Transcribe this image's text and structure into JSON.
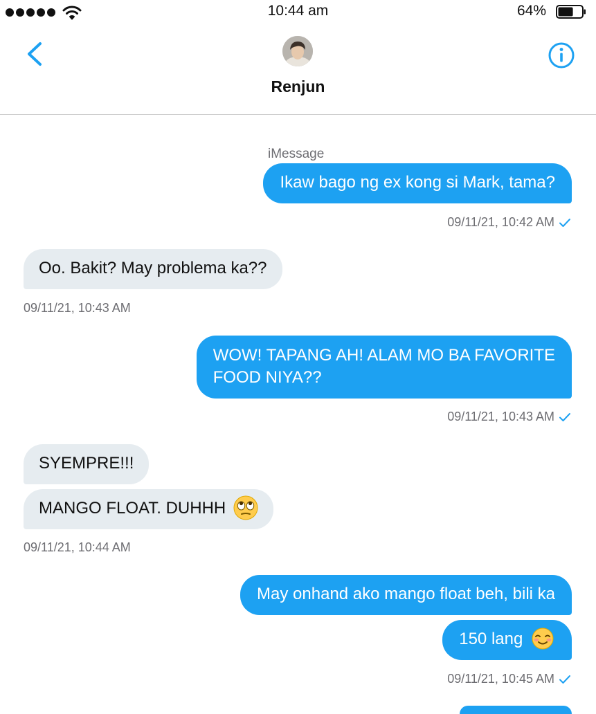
{
  "status_bar": {
    "time": "10:44 am",
    "battery_percent": "64%",
    "battery_level": 0.64,
    "icons": [
      "signal-dots-icon",
      "wifi-icon",
      "battery-icon"
    ]
  },
  "header": {
    "contact_name": "Renjun",
    "icons": [
      "back-chevron-icon",
      "info-icon"
    ],
    "accent_color": "#1da1f2"
  },
  "conversation": {
    "service_label": "iMessage",
    "messages": [
      {
        "direction": "out",
        "text": "Ikaw bago ng ex kong si Mark, tama?"
      },
      {
        "direction": "in",
        "text": "Oo. Bakit? May problema ka??"
      },
      {
        "direction": "out",
        "text": "WOW! TAPANG AH! ALAM MO BA FAVORITE",
        "text2": "FOOD NIYA??"
      },
      {
        "direction": "in",
        "text": "SYEMPRE!!!"
      },
      {
        "direction": "in",
        "text": "MANGO FLOAT. DUHHH",
        "emoji": "rolling-eyes-emoji"
      },
      {
        "direction": "out",
        "text": "May onhand ako mango float beh, bili ka"
      },
      {
        "direction": "out",
        "text": "150 lang",
        "emoji": "smiling-blush-emoji"
      }
    ],
    "timestamps": [
      "09/11/21, 10:42 AM",
      "09/11/21, 10:43 AM",
      "09/11/21, 10:43 AM",
      "09/11/21, 10:44 AM",
      "09/11/21, 10:45 AM"
    ],
    "colors": {
      "outgoing_bubble": "#1da1f2",
      "incoming_bubble": "#e6ecf0",
      "timestamp_text": "#6d6d72"
    }
  }
}
